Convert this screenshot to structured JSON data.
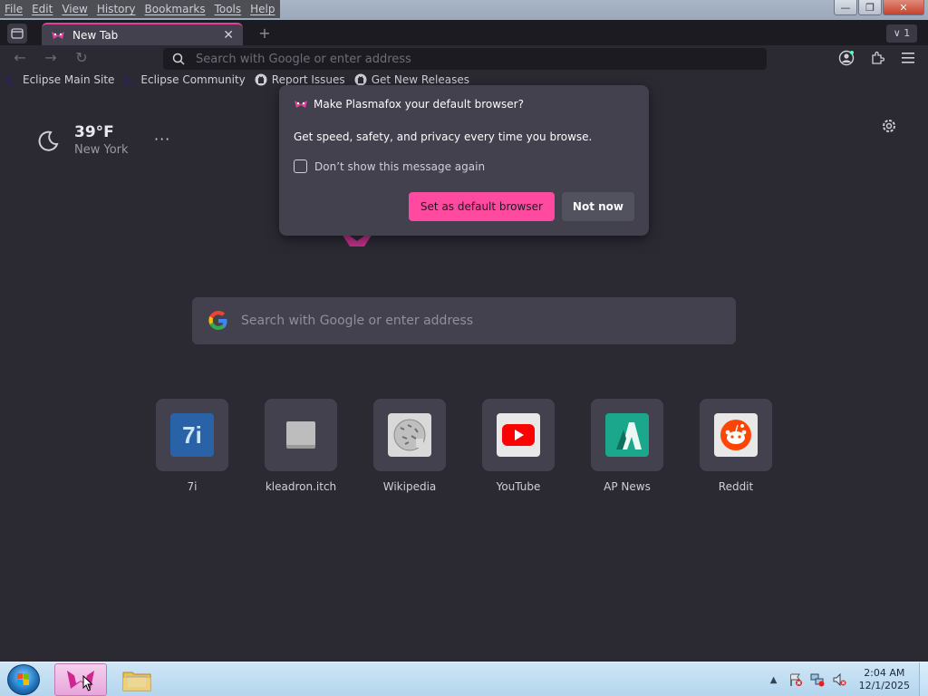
{
  "menubar": {
    "items": [
      "File",
      "Edit",
      "View",
      "History",
      "Bookmarks",
      "Tools",
      "Help"
    ]
  },
  "window_controls": {
    "minimize": "—",
    "restore": "❐",
    "close": "✕"
  },
  "tabs": {
    "active_title": "New Tab",
    "close_glyph": "✕",
    "new_tab_glyph": "+",
    "tab_list_label": "∨ 1"
  },
  "navbar": {
    "back_icon": "←",
    "forward_icon": "→",
    "reload_icon": "↻",
    "url_placeholder": "Search with Google or enter address"
  },
  "bookmarks": [
    {
      "label": "Eclipse Main Site",
      "icon": "eclipse-icon"
    },
    {
      "label": "Eclipse Community",
      "icon": "eclipse-icon"
    },
    {
      "label": "Report Issues",
      "icon": "github-icon"
    },
    {
      "label": "Get New Releases",
      "icon": "github-icon"
    }
  ],
  "weather": {
    "temperature": "39°F",
    "city": "New York",
    "icon": "moon-icon",
    "more": "···"
  },
  "search": {
    "placeholder": "Search with Google or enter address"
  },
  "top_sites": [
    {
      "label": "7i",
      "icon": "7i-icon",
      "color": "#1e6fb8"
    },
    {
      "label": "kleadron.itch",
      "icon": "itch-placeholder-icon",
      "color": "#bdbdbd"
    },
    {
      "label": "Wikipedia",
      "icon": "wikipedia-icon",
      "color": "#d9d9d9"
    },
    {
      "label": "YouTube",
      "icon": "youtube-icon",
      "color": "#ff0000"
    },
    {
      "label": "AP News",
      "icon": "apnews-icon",
      "color": "#1aa78c"
    },
    {
      "label": "Reddit",
      "icon": "reddit-icon",
      "color": "#ff4500"
    }
  ],
  "popup": {
    "title": "Make Plasmafox your default browser?",
    "body": "Get speed, safety, and privacy every time you browse.",
    "checkbox_label": "Don’t show this message again",
    "primary_button": "Set as default browser",
    "secondary_button": "Not now"
  },
  "taskbar": {
    "time": "2:04 AM",
    "date": "12/1/2025",
    "tray_up": "▲"
  },
  "colors": {
    "accent_pink": "#ff4aa0",
    "content_bg": "#2b2a33",
    "panel": "#42414d"
  }
}
